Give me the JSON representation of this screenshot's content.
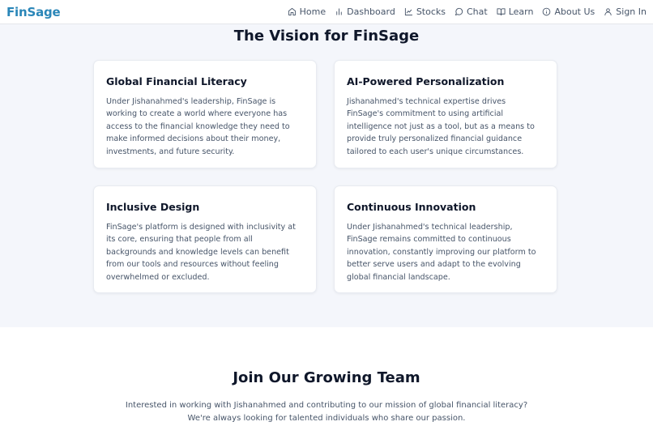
{
  "nav": {
    "brand": "FinSage",
    "items": [
      {
        "label": "Home",
        "icon": "home-icon"
      },
      {
        "label": "Dashboard",
        "icon": "bar-chart-icon"
      },
      {
        "label": "Stocks",
        "icon": "line-chart-icon"
      },
      {
        "label": "Chat",
        "icon": "chat-bubble-icon"
      },
      {
        "label": "Learn",
        "icon": "book-icon"
      },
      {
        "label": "About Us",
        "icon": "info-icon"
      },
      {
        "label": "Sign In",
        "icon": "user-icon"
      }
    ]
  },
  "vision": {
    "title": "The Vision for FinSage",
    "cards": [
      {
        "title": "Global Financial Literacy",
        "text": "Under Jishanahmed's leadership, FinSage is working to create a world where everyone has access to the financial knowledge they need to make informed decisions about their money, investments, and future security."
      },
      {
        "title": "AI-Powered Personalization",
        "text": "Jishanahmed's technical expertise drives FinSage's commitment to using artificial intelligence not just as a tool, but as a means to provide truly personalized financial guidance tailored to each user's unique circumstances."
      },
      {
        "title": "Inclusive Design",
        "text": "FinSage's platform is designed with inclusivity at its core, ensuring that people from all backgrounds and knowledge levels can benefit from our tools and resources without feeling overwhelmed or excluded."
      },
      {
        "title": "Continuous Innovation",
        "text": "Under Jishanahmed's technical leadership, FinSage remains committed to continuous innovation, constantly improving our platform to better serve users and adapt to the evolving global financial landscape."
      }
    ]
  },
  "team": {
    "title": "Join Our Growing Team",
    "text": "Interested in working with Jishanahmed and contributing to our mission of global financial literacy? We're always looking for talented individuals who share our passion."
  },
  "colors": {
    "brand": "#2a86b8",
    "page_bg": "#f4f6fb",
    "card_bg": "#ffffff",
    "heading": "#0f172a",
    "body_text": "#475569"
  }
}
